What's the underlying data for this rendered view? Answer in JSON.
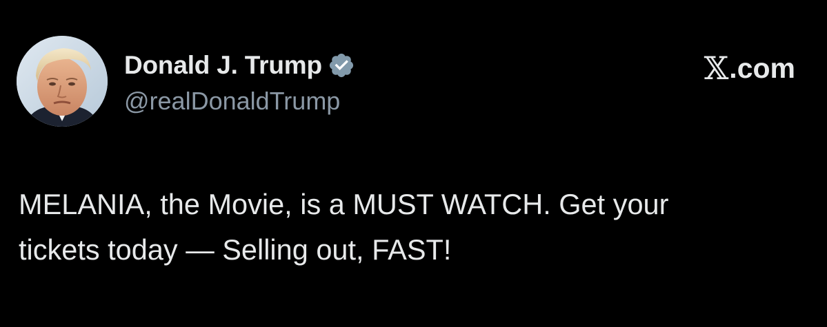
{
  "author": {
    "display_name": "Donald J. Trump",
    "handle": "@realDonaldTrump",
    "verified": true
  },
  "brand": {
    "x_glyph": "𝕏",
    "suffix": ".com"
  },
  "tweet": {
    "lines": [
      "MELANIA, the Movie, is a MUST WATCH. Get your",
      "tickets today — Selling out, FAST!"
    ]
  },
  "icons": {
    "verified": "verified-badge-icon",
    "avatar": "profile-photo"
  },
  "colors": {
    "background": "#000000",
    "text_primary": "#e7e9ea",
    "text_secondary": "#8b98a5",
    "verified_badge": "#829aab"
  }
}
